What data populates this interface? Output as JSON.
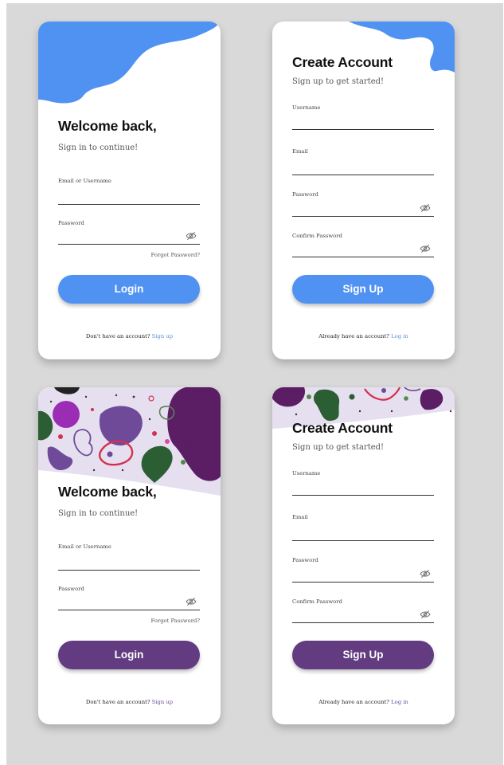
{
  "colors": {
    "blue_accent": "#5092f2",
    "blue_link": "#5b8fd6",
    "purple_accent": "#623b80",
    "purple_link": "#6c4a9a",
    "background": "#d9d9d9"
  },
  "login": {
    "title": "Welcome back,",
    "subtitle": "Sign in to continue!",
    "email_label": "Email or Username",
    "password_label": "Password",
    "forgot_password": "Forgot Password?",
    "button": "Login",
    "footer_text": "Don't have an account?",
    "footer_link": "Sign up",
    "password_toggle_icon": "eye-slash-icon"
  },
  "signup": {
    "title": "Create Account",
    "subtitle": "Sign up to get started!",
    "username_label": "Username",
    "email_label": "Email",
    "password_label": "Password",
    "confirm_password_label": "Confirm Password",
    "button": "Sign Up",
    "footer_text": "Already have an account?",
    "footer_link": "Log in",
    "password_toggle_icon": "eye-slash-icon"
  },
  "variants": [
    "blue",
    "purple"
  ]
}
